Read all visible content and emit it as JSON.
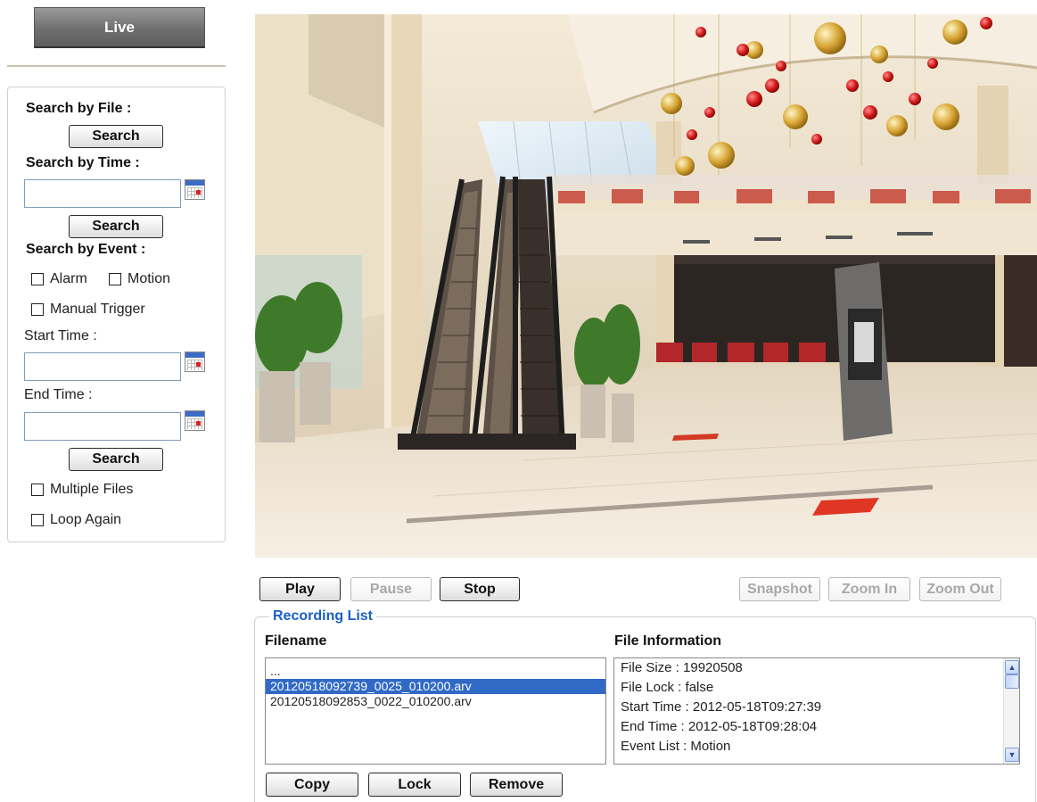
{
  "live_button": "Live",
  "search": {
    "by_file_label": "Search by File :",
    "by_file_button": "Search",
    "by_time_label": "Search by Time :",
    "by_time_value": "",
    "by_time_button": "Search",
    "by_event_label": "Search by Event :",
    "alarm_label": "Alarm",
    "motion_label": "Motion",
    "manual_trigger_label": "Manual Trigger",
    "start_time_label": "Start Time :",
    "start_time_value": "",
    "end_time_label": "End Time :",
    "end_time_value": "",
    "by_event_button": "Search",
    "multiple_files_label": "Multiple Files",
    "loop_again_label": "Loop Again"
  },
  "player": {
    "play": "Play",
    "pause": "Pause",
    "stop": "Stop",
    "snapshot": "Snapshot",
    "zoom_in": "Zoom In",
    "zoom_out": "Zoom Out"
  },
  "recording": {
    "legend": "Recording List",
    "filename_header": "Filename",
    "info_header": "File Information",
    "files": [
      "...",
      "20120518092739_0025_010200.arv",
      "20120518092853_0022_010200.arv"
    ],
    "selected_index": 1,
    "info": [
      "File Size : 19920508",
      "File Lock : false",
      "Start Time : 2012-05-18T09:27:39",
      "End Time : 2012-05-18T09:28:04",
      "Event List : Motion"
    ],
    "copy": "Copy",
    "lock": "Lock",
    "remove": "Remove"
  },
  "colors": {
    "legend_blue": "#1a5fc4",
    "selection_blue": "#3169c6"
  }
}
